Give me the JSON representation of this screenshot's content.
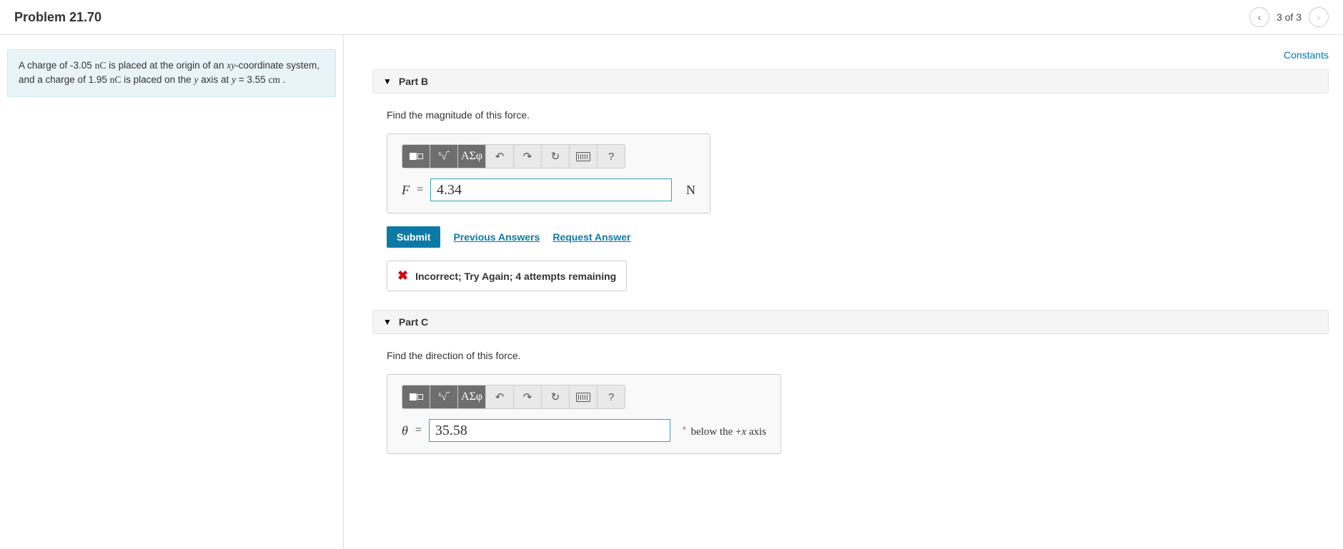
{
  "header": {
    "title": "Problem 21.70",
    "page_indicator": "3 of 3"
  },
  "problem": {
    "text_pre": "A charge of -3.05 ",
    "unit1": "nC",
    "text_mid1": " is placed at the origin of an ",
    "xy": "xy",
    "text_mid2": "-coordinate system, and a charge of 1.95 ",
    "unit2": "nC",
    "text_mid3": " is placed on the ",
    "yaxis": "y",
    "text_mid4": " axis at ",
    "yvar": "y",
    "text_mid5": " = 3.55 ",
    "cm": "cm",
    "text_end": " ."
  },
  "constants_link": "Constants",
  "partB": {
    "label": "Part B",
    "prompt": "Find the magnitude of this force.",
    "var": "F",
    "eq": "=",
    "value": "4.34",
    "unit": "N",
    "submit": "Submit",
    "prev": "Previous Answers",
    "req": "Request Answer",
    "feedback": "Incorrect; Try Again; 4 attempts remaining"
  },
  "partC": {
    "label": "Part C",
    "prompt": "Find the direction of this force.",
    "var": "θ",
    "eq": "=",
    "value": "35.58",
    "suffix_pre": "below the ",
    "suffix_plus": "+",
    "suffix_x": "x",
    "suffix_post": " axis"
  },
  "toolbar": {
    "greek": "ΑΣφ",
    "help": "?"
  }
}
